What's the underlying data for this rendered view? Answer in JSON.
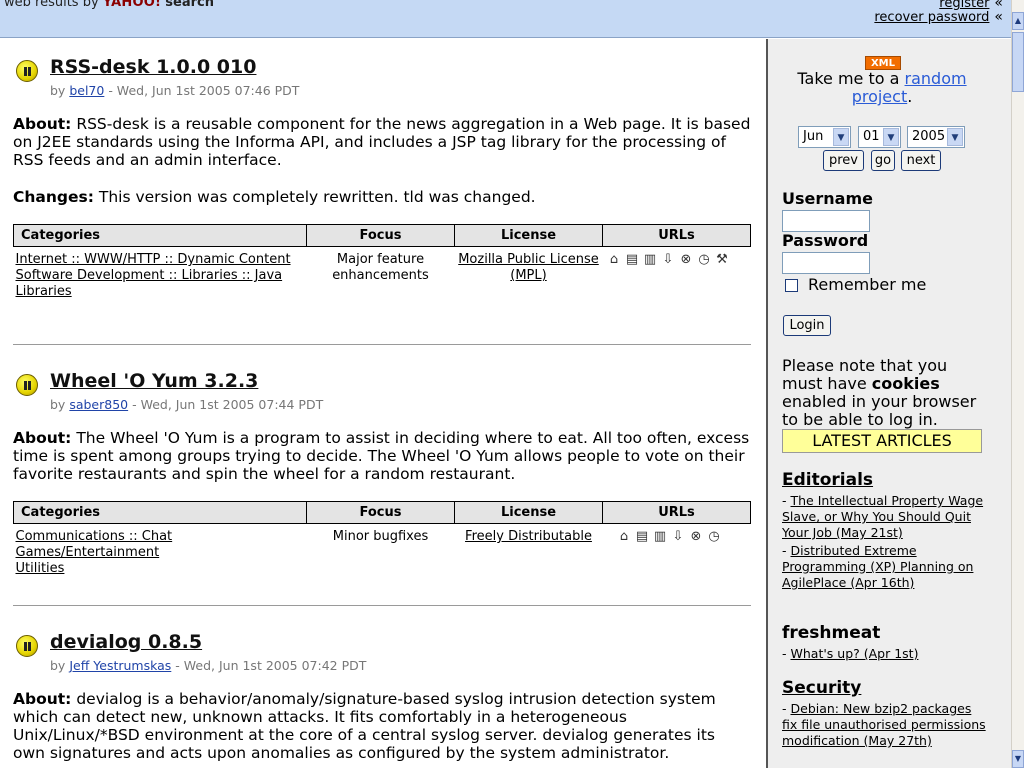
{
  "header": {
    "prefix": "web results by",
    "yahoo": "YAHOO!",
    "search": "search",
    "register": "register",
    "recover": "recover password",
    "chevron": "«",
    "bg_color": "#c5d9f4"
  },
  "projects": [
    {
      "title": "RSS-desk 1.0.0 010",
      "by": "by",
      "author": "bel70",
      "date": "- Wed, Jun 1st 2005 07:46 PDT",
      "about_label": "About:",
      "about": "RSS-desk is a reusable component for the news aggregation in a Web page. It is based on J2EE standards using the Informa API, and includes a JSP tag library for the processing of RSS feeds and an admin interface.",
      "changes_label": "Changes:",
      "changes": "This version was completely rewritten. tld was changed.",
      "categories": [
        "Internet :: WWW/HTTP :: Dynamic Content",
        "Software Development :: Libraries :: Java Libraries"
      ],
      "focus": "Major feature enhancements",
      "license": "Mozilla Public License (MPL)",
      "url_icons": [
        "home-icon",
        "download-tgz-icon",
        "download-zip-icon",
        "download-rpm-icon",
        "cvs-icon",
        "changelog-icon",
        "tools-icon"
      ]
    },
    {
      "title": "Wheel 'O Yum 3.2.3",
      "by": "by",
      "author": "saber850",
      "date": "- Wed, Jun 1st 2005 07:44 PDT",
      "about_label": "About:",
      "about": "The Wheel 'O Yum is a program to assist in deciding where to eat. All too often, excess time is spent among groups trying to decide. The Wheel 'O Yum allows people to vote on their favorite restaurants and spin the wheel for a random restaurant.",
      "categories": [
        "Communications :: Chat",
        "Games/Entertainment",
        "Utilities"
      ],
      "focus": "Minor bugfixes",
      "license": "Freely Distributable",
      "url_icons": [
        "home-icon",
        "download-tgz-icon",
        "download-zip-icon",
        "download-rpm-icon",
        "cvs-icon",
        "changelog-icon"
      ]
    },
    {
      "title": "devialog 0.8.5",
      "by": "by",
      "author": "Jeff Yestrumskas",
      "date": "- Wed, Jun 1st 2005 07:42 PDT",
      "about_label": "About:",
      "about": "devialog is a behavior/anomaly/signature-based syslog intrusion detection system which can detect new, unknown attacks. It fits comfortably in a heterogeneous Unix/Linux/*BSD environment at the core of a central syslog server. devialog generates its own signatures and acts upon anomalies as configured by the system administrator."
    }
  ],
  "table_headers": {
    "categories": "Categories",
    "focus": "Focus",
    "license": "License",
    "urls": "URLs"
  },
  "sidebar": {
    "xml": "XML",
    "random_prefix": "Take me to a",
    "random_link": "random project",
    "random_suffix": ".",
    "month": "Jun",
    "day": "01",
    "year": "2005",
    "prev": "prev",
    "go": "go",
    "next": "next",
    "username_label": "Username",
    "password_label": "Password",
    "remember": "Remember me",
    "login": "Login",
    "note_pre": "Please note that you must have",
    "note_bold": "cookies",
    "note_post": "enabled in your browser to be able to log in.",
    "latest": "LATEST ARTICLES",
    "sections": [
      {
        "heading": "Editorials",
        "items": [
          "The Intellectual Property Wage Slave, or Why You Should Quit Your Job (May 21st)",
          "Distributed Extreme Programming (XP) Planning on AgilePlace (Apr 16th)"
        ]
      },
      {
        "heading": "freshmeat",
        "items": [
          "What's up? (Apr 1st)"
        ]
      },
      {
        "heading": "Security",
        "items": [
          "Debian: New bzip2 packages fix file unauthorised permissions modification (May 27th)"
        ]
      }
    ],
    "dash": "-",
    "bg_color": "#eeeeee"
  }
}
